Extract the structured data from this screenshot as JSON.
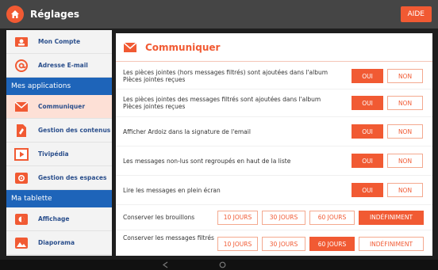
{
  "app": {
    "title": "Réglages",
    "help_label": "AIDE"
  },
  "sidebar": {
    "items_top": [
      {
        "label": "Mon Compte",
        "icon": "person-card-icon"
      },
      {
        "label": "Adresse E-mail",
        "icon": "at-sign-icon"
      }
    ],
    "section1": "Mes applications",
    "items_apps": [
      {
        "label": "Communiquer",
        "icon": "envelope-icon",
        "active": true
      },
      {
        "label": "Gestion des contenus",
        "icon": "document-icon"
      },
      {
        "label": "Tivipédia",
        "icon": "play-icon"
      },
      {
        "label": "Gestion des espaces",
        "icon": "gear-icon"
      }
    ],
    "section2": "Ma tablette",
    "items_tablet": [
      {
        "label": "Affichage",
        "icon": "display-icon"
      },
      {
        "label": "Diaporama",
        "icon": "picture-icon"
      }
    ]
  },
  "content": {
    "title": "Communiquer",
    "rows": [
      {
        "label": "Les pièces jointes (hors messages filtrés) sont ajoutées dans l'album Pièces jointes reçues",
        "on": "OUI",
        "off": "NON",
        "value": "OUI"
      },
      {
        "label": "Les pièces jointes des messages filtrés sont ajoutées dans l'album Pièces jointes reçues",
        "on": "OUI",
        "off": "NON",
        "value": "OUI"
      },
      {
        "label": "Afficher Ardoiz dans la signature de l'email",
        "on": "OUI",
        "off": "NON",
        "value": "OUI"
      },
      {
        "label": "Les messages non-lus sont regroupés en haut de la liste",
        "on": "OUI",
        "off": "NON",
        "value": "OUI"
      },
      {
        "label": "Lire les messages en plein écran",
        "on": "OUI",
        "off": "NON",
        "value": "OUI"
      }
    ],
    "keep_drafts": {
      "label": "Conserver les brouillons",
      "options": [
        "10 JOURS",
        "30 JOURS",
        "60 JOURS",
        "INDÉFINIMENT"
      ],
      "selected": "INDÉFINIMENT"
    },
    "keep_filtered": {
      "label": "Conserver les messages filtrés",
      "options": [
        "10 JOURS",
        "30 JOURS",
        "60 JOURS",
        "INDÉFINIMENT"
      ],
      "selected": "60 JOURS"
    }
  },
  "colors": {
    "accent": "#f15a33",
    "nav_blue": "#1e64b9",
    "topbar": "#454545"
  }
}
